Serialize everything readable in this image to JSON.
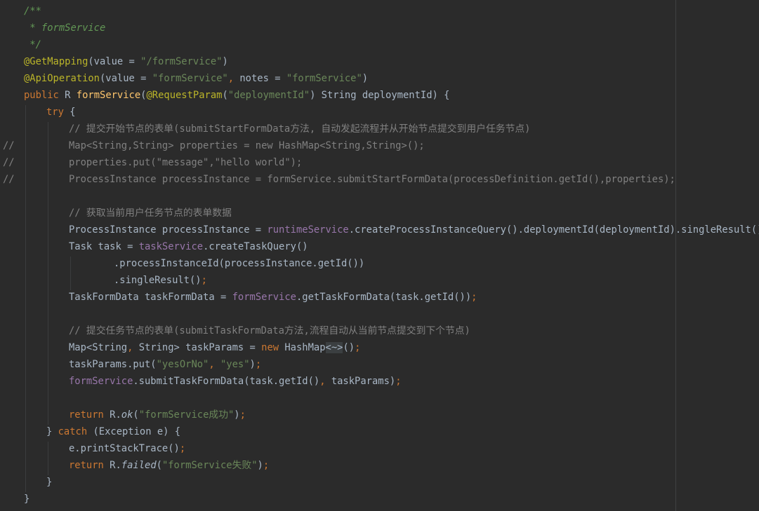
{
  "colors": {
    "background": "#2b2b2b",
    "plain": "#a9b7c6",
    "keyword": "#cc7832",
    "string": "#6a8759",
    "annotation": "#bbb529",
    "doc_comment": "#629755",
    "line_comment": "#808080",
    "field": "#9876aa",
    "method_declaration": "#ffc66d"
  },
  "lines": [
    {
      "gutter": "",
      "indent": 34,
      "tokens": [
        {
          "s": "comment",
          "t": "/**"
        }
      ]
    },
    {
      "gutter": "",
      "indent": 34,
      "tokens": [
        {
          "s": "comment",
          "t": " * formService"
        }
      ]
    },
    {
      "gutter": "",
      "indent": 34,
      "tokens": [
        {
          "s": "comment",
          "t": " */"
        }
      ]
    },
    {
      "gutter": "",
      "indent": 34,
      "tokens": [
        {
          "s": "annotation",
          "t": "@GetMapping"
        },
        {
          "s": "plain",
          "t": "(value = "
        },
        {
          "s": "string",
          "t": "\"/formService\""
        },
        {
          "s": "plain",
          "t": ")"
        }
      ]
    },
    {
      "gutter": "",
      "indent": 34,
      "tokens": [
        {
          "s": "annotation",
          "t": "@ApiOperation"
        },
        {
          "s": "plain",
          "t": "(value = "
        },
        {
          "s": "string",
          "t": "\"formService\""
        },
        {
          "s": "keyword",
          "t": ", "
        },
        {
          "s": "plain",
          "t": "notes = "
        },
        {
          "s": "string",
          "t": "\"formService\""
        },
        {
          "s": "plain",
          "t": ")"
        }
      ]
    },
    {
      "gutter": "",
      "indent": 34,
      "tokens": [
        {
          "s": "keyword",
          "t": "public "
        },
        {
          "s": "plain",
          "t": "R "
        },
        {
          "s": "method",
          "t": "formService"
        },
        {
          "s": "plain",
          "t": "("
        },
        {
          "s": "annotation",
          "t": "@RequestParam"
        },
        {
          "s": "plain",
          "t": "("
        },
        {
          "s": "string",
          "t": "\"deploymentId\""
        },
        {
          "s": "plain",
          "t": ") String deploymentId) {"
        }
      ]
    },
    {
      "gutter": "",
      "indent": 66,
      "tokens": [
        {
          "s": "keyword",
          "t": "try "
        },
        {
          "s": "plain",
          "t": "{"
        }
      ]
    },
    {
      "gutter": "",
      "indent": 98,
      "tokens": [
        {
          "s": "linecomment",
          "t": "// 提交开始节点的表单(submitStartFormData方法, 自动发起流程并从开始节点提交到用户任务节点)"
        }
      ]
    },
    {
      "gutter": "//",
      "indent": 98,
      "tokens": [
        {
          "s": "linecomment",
          "t": "Map<String,String> properties = new HashMap<String,String>();"
        }
      ]
    },
    {
      "gutter": "//",
      "indent": 98,
      "tokens": [
        {
          "s": "linecomment",
          "t": "properties.put(\"message\",\"hello world\");"
        }
      ]
    },
    {
      "gutter": "//",
      "indent": 98,
      "tokens": [
        {
          "s": "linecomment",
          "t": "ProcessInstance processInstance = formService.submitStartFormData(processDefinition.getId(),properties);"
        }
      ]
    },
    {
      "gutter": "",
      "indent": 98,
      "tokens": []
    },
    {
      "gutter": "",
      "indent": 98,
      "tokens": [
        {
          "s": "linecomment",
          "t": "// 获取当前用户任务节点的表单数据"
        }
      ]
    },
    {
      "gutter": "",
      "indent": 98,
      "tokens": [
        {
          "s": "plain",
          "t": "ProcessInstance processInstance = "
        },
        {
          "s": "field",
          "t": "runtimeService"
        },
        {
          "s": "plain",
          "t": ".createProcessInstanceQuery().deploymentId(deploymentId).singleResult()"
        },
        {
          "s": "keyword",
          "t": ";"
        }
      ]
    },
    {
      "gutter": "",
      "indent": 98,
      "tokens": [
        {
          "s": "plain",
          "t": "Task task = "
        },
        {
          "s": "field",
          "t": "taskService"
        },
        {
          "s": "plain",
          "t": ".createTaskQuery()"
        }
      ]
    },
    {
      "gutter": "",
      "indent": 162,
      "tokens": [
        {
          "s": "plain",
          "t": ".processInstanceId(processInstance.getId())"
        }
      ]
    },
    {
      "gutter": "",
      "indent": 162,
      "tokens": [
        {
          "s": "plain",
          "t": ".singleResult()"
        },
        {
          "s": "keyword",
          "t": ";"
        }
      ]
    },
    {
      "gutter": "",
      "indent": 98,
      "tokens": [
        {
          "s": "plain",
          "t": "TaskFormData taskFormData = "
        },
        {
          "s": "field",
          "t": "formService"
        },
        {
          "s": "plain",
          "t": ".getTaskFormData(task.getId())"
        },
        {
          "s": "keyword",
          "t": ";"
        }
      ]
    },
    {
      "gutter": "",
      "indent": 98,
      "tokens": []
    },
    {
      "gutter": "",
      "indent": 98,
      "tokens": [
        {
          "s": "linecomment",
          "t": "// 提交任务节点的表单(submitTaskFormData方法,流程自动从当前节点提交到下个节点)"
        }
      ]
    },
    {
      "gutter": "",
      "indent": 98,
      "tokens": [
        {
          "s": "plain",
          "t": "Map<String"
        },
        {
          "s": "keyword",
          "t": ", "
        },
        {
          "s": "plain",
          "t": "String> taskParams = "
        },
        {
          "s": "keyword",
          "t": "new "
        },
        {
          "s": "plain",
          "t": "HashMap"
        },
        {
          "s": "folded",
          "t": "<~>"
        },
        {
          "s": "plain",
          "t": "()"
        },
        {
          "s": "keyword",
          "t": ";"
        }
      ]
    },
    {
      "gutter": "",
      "indent": 98,
      "tokens": [
        {
          "s": "plain",
          "t": "taskParams.put("
        },
        {
          "s": "string",
          "t": "\"yesOrNo\""
        },
        {
          "s": "keyword",
          "t": ", "
        },
        {
          "s": "string",
          "t": "\"yes\""
        },
        {
          "s": "plain",
          "t": ")"
        },
        {
          "s": "keyword",
          "t": ";"
        }
      ]
    },
    {
      "gutter": "",
      "indent": 98,
      "tokens": [
        {
          "s": "field",
          "t": "formService"
        },
        {
          "s": "plain",
          "t": ".submitTaskFormData(task.getId()"
        },
        {
          "s": "keyword",
          "t": ", "
        },
        {
          "s": "plain",
          "t": "taskParams)"
        },
        {
          "s": "keyword",
          "t": ";"
        }
      ]
    },
    {
      "gutter": "",
      "indent": 98,
      "tokens": []
    },
    {
      "gutter": "",
      "indent": 98,
      "tokens": [
        {
          "s": "keyword",
          "t": "return "
        },
        {
          "s": "plain",
          "t": "R."
        },
        {
          "s": "static",
          "t": "ok"
        },
        {
          "s": "plain",
          "t": "("
        },
        {
          "s": "string",
          "t": "\"formService成功\""
        },
        {
          "s": "plain",
          "t": ")"
        },
        {
          "s": "keyword",
          "t": ";"
        }
      ]
    },
    {
      "gutter": "",
      "indent": 66,
      "tokens": [
        {
          "s": "plain",
          "t": "} "
        },
        {
          "s": "keyword",
          "t": "catch "
        },
        {
          "s": "plain",
          "t": "(Exception e) {"
        }
      ]
    },
    {
      "gutter": "",
      "indent": 98,
      "tokens": [
        {
          "s": "plain",
          "t": "e.printStackTrace()"
        },
        {
          "s": "keyword",
          "t": ";"
        }
      ]
    },
    {
      "gutter": "",
      "indent": 98,
      "tokens": [
        {
          "s": "keyword",
          "t": "return "
        },
        {
          "s": "plain",
          "t": "R."
        },
        {
          "s": "static",
          "t": "failed"
        },
        {
          "s": "plain",
          "t": "("
        },
        {
          "s": "string",
          "t": "\"formService失败\""
        },
        {
          "s": "plain",
          "t": ")"
        },
        {
          "s": "keyword",
          "t": ";"
        }
      ]
    },
    {
      "gutter": "",
      "indent": 66,
      "tokens": [
        {
          "s": "plain",
          "t": "}"
        }
      ]
    },
    {
      "gutter": "",
      "indent": 34,
      "tokens": [
        {
          "s": "plain",
          "t": "}"
        }
      ]
    }
  ]
}
